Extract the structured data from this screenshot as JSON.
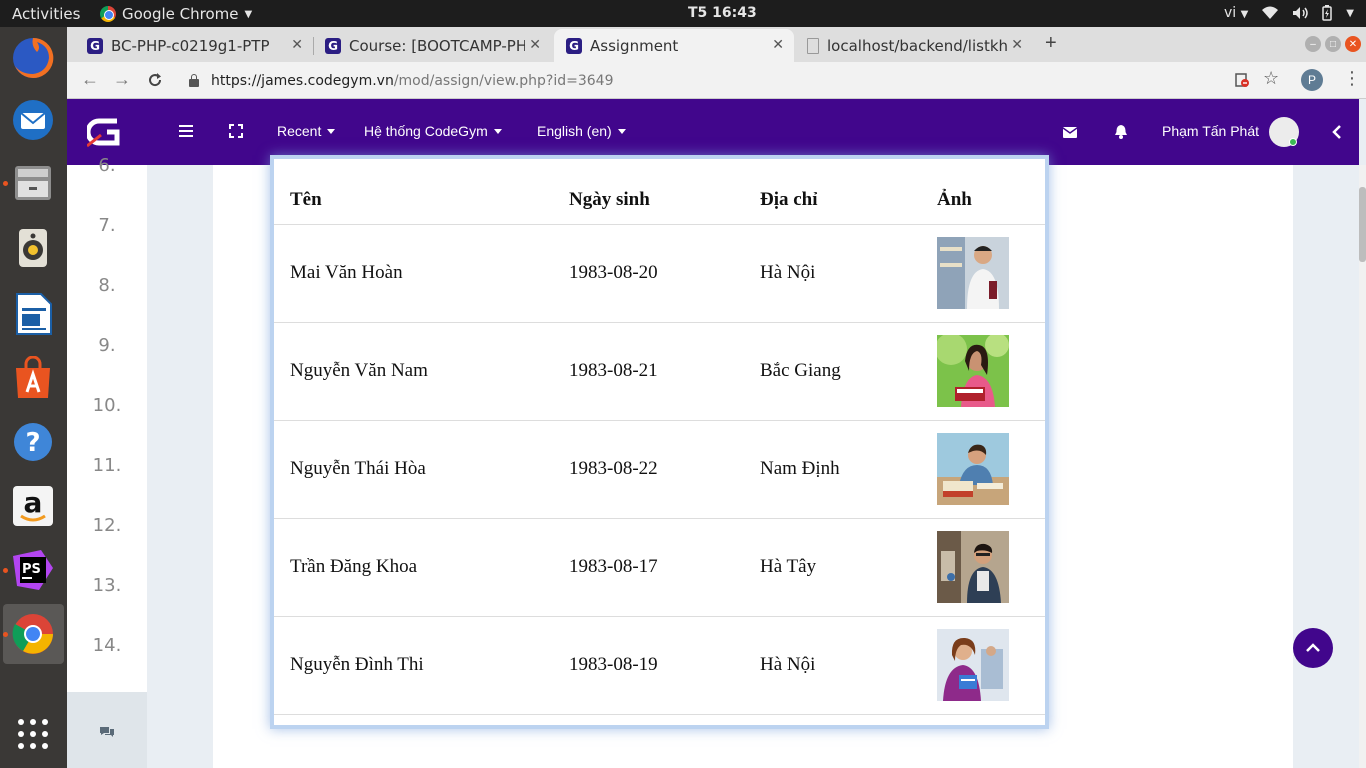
{
  "os": {
    "activities": "Activities",
    "app_name": "Google Chrome",
    "clock": "T5 16:43",
    "keyboard_layout": "vi"
  },
  "browser": {
    "tabs": [
      {
        "title": "BC-PHP-c0219g1-PTP",
        "active": false
      },
      {
        "title": "Course: [BOOTCAMP-PHP",
        "active": false
      },
      {
        "title": "Assignment",
        "active": true
      },
      {
        "title": "localhost/backend/listkh",
        "active": false
      }
    ],
    "url_host": "https://james.codegym.vn",
    "url_path": "/mod/assign/view.php?id=3649",
    "profile_initial": "P"
  },
  "site": {
    "nav": {
      "recent": "Recent",
      "system": "Hệ thống CodeGym",
      "language": "English (en)",
      "user_name": "Phạm Tấn Phát"
    },
    "colors": {
      "brand": "#41068c"
    },
    "side_numbers": [
      "6.",
      "7.",
      "8.",
      "9.",
      "10.",
      "11.",
      "12.",
      "13.",
      "14."
    ]
  },
  "table": {
    "headers": [
      "Tên",
      "Ngày sinh",
      "Địa chỉ",
      "Ảnh"
    ],
    "rows": [
      {
        "name": "Mai Văn Hoàn",
        "dob": "1983-08-20",
        "address": "Hà Nội"
      },
      {
        "name": "Nguyễn Văn Nam",
        "dob": "1983-08-21",
        "address": "Bắc Giang"
      },
      {
        "name": "Nguyễn Thái Hòa",
        "dob": "1983-08-22",
        "address": "Nam Định"
      },
      {
        "name": "Trần Đăng Khoa",
        "dob": "1983-08-17",
        "address": "Hà Tây"
      },
      {
        "name": "Nguyễn Đình Thi",
        "dob": "1983-08-19",
        "address": "Hà Nội"
      }
    ]
  }
}
